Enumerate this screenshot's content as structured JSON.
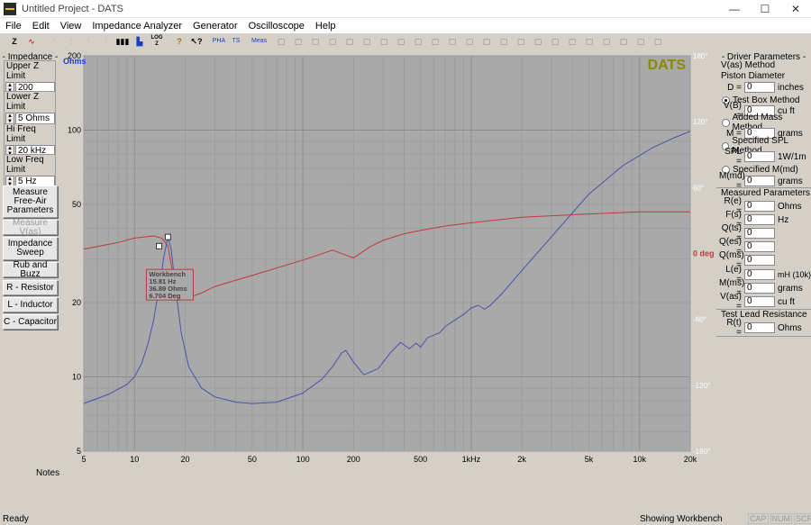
{
  "window": {
    "title": "Untitled Project - DATS",
    "min": "—",
    "max": "☐",
    "close": "✕"
  },
  "menu": [
    "File",
    "Edit",
    "View",
    "Impedance Analyzer",
    "Generator",
    "Oscilloscope",
    "Help"
  ],
  "toolbar": {
    "icons": [
      "impedance-z-icon",
      "waveform-icon",
      "measure-icon",
      "measure-icon-2",
      "measure-icon-3",
      "measure-icon-4",
      "bars-icon",
      "bar-chart-icon",
      "log-z-icon",
      "help-icon",
      "context-help-icon",
      "pha-icon",
      "ts-icon",
      "meas-icon"
    ],
    "labels": {
      "z": "Z",
      "log": "LOG Z",
      "pha": "PHA",
      "ts": "TS",
      "meas": "Meas"
    }
  },
  "left": {
    "header": "- Impedance -",
    "upper_label": "Upper Z Limit",
    "upper_value": "200 Ohms",
    "lower_label": "Lower Z Limit",
    "lower_value": "5 Ohms",
    "hi_label": "Hi Freq Limit",
    "hi_value": "20 kHz",
    "low_label": "Low Freq Limit",
    "low_value": "5 Hz",
    "btn_freeair": "Measure Free-Air Parameters",
    "btn_vas": "Measure V(as)",
    "btn_sweep": "Impedance Sweep",
    "btn_rub": "Rub and Buzz",
    "btn_r": "R - Resistor",
    "btn_l": "L - Inductor",
    "btn_c": "C - Capacitor"
  },
  "chart_data": {
    "type": "line",
    "brand": "DATS",
    "y_axis_label": "Ohms",
    "y_log": true,
    "x_log": true,
    "ylim": [
      5,
      200
    ],
    "xlim": [
      5,
      20000
    ],
    "y_ticks": [
      "5",
      "10",
      "20",
      "50",
      "100",
      "200"
    ],
    "y_ticks_values": [
      5,
      10,
      20,
      50,
      100,
      200
    ],
    "x_ticks": [
      "5",
      "10",
      "20",
      "50",
      "100",
      "200",
      "500",
      "1kHz",
      "2k",
      "5k",
      "10k",
      "20k"
    ],
    "x_ticks_values": [
      5,
      10,
      20,
      50,
      100,
      200,
      500,
      1000,
      2000,
      5000,
      10000,
      20000
    ],
    "phase_ticks": [
      "180°",
      "120°",
      "60°",
      "0 deg",
      "-60°",
      "-120°",
      "-180°"
    ],
    "phase_ticks_values": [
      180,
      120,
      60,
      0,
      -60,
      -120,
      -180
    ],
    "phase_lim": [
      -180,
      180
    ],
    "colors": {
      "impedance": "#4a50b0",
      "phase": "#c0393b",
      "zero_label": "#c0393b",
      "brand": "#8a8a00"
    },
    "series": [
      {
        "name": "Impedance",
        "axis": "ohms",
        "x": [
          5,
          7,
          9,
          10,
          11,
          12,
          13,
          14,
          15,
          15.81,
          16.5,
          17.5,
          19,
          21,
          25,
          30,
          40,
          50,
          70,
          100,
          130,
          150,
          170,
          180,
          200,
          230,
          280,
          330,
          380,
          430,
          470,
          500,
          550,
          650,
          700,
          800,
          900,
          1000,
          1100,
          1200,
          1300,
          1500,
          2000,
          3000,
          5000,
          8000,
          12000,
          16000,
          20000
        ],
        "y": [
          7.8,
          8.5,
          9.3,
          10.0,
          11.3,
          13.5,
          17.0,
          23.0,
          31.0,
          36.89,
          33.0,
          23.0,
          15.0,
          11.0,
          9.0,
          8.3,
          7.9,
          7.8,
          7.9,
          8.6,
          9.8,
          11.0,
          12.5,
          12.8,
          11.5,
          10.2,
          10.8,
          12.5,
          13.8,
          13.0,
          13.7,
          13.2,
          14.4,
          15.1,
          16.0,
          17.0,
          17.9,
          19.0,
          19.5,
          18.8,
          19.5,
          21.5,
          27.0,
          37.0,
          55.0,
          72.0,
          85.0,
          93.0,
          99.0
        ]
      },
      {
        "name": "Phase",
        "axis": "deg",
        "x": [
          5,
          8,
          10,
          13,
          14.5,
          15.81,
          16.5,
          17.5,
          19,
          21,
          25,
          30,
          50,
          100,
          150,
          200,
          250,
          300,
          400,
          500,
          700,
          1000,
          1500,
          2000,
          5000,
          10000,
          20000
        ],
        "y": [
          4,
          10,
          14,
          16,
          14,
          6.7,
          -10,
          -28,
          -36,
          -40,
          -36,
          -30,
          -20,
          -6,
          3,
          -4,
          6,
          12,
          18,
          21,
          25,
          28,
          31,
          33,
          36,
          38,
          38
        ]
      }
    ],
    "cursor": {
      "x": 15.81,
      "title": "Workbench",
      "freq": "15.81 Hz",
      "ohms": "36.89 Ohms",
      "deg": "6.704 Deg"
    }
  },
  "right": {
    "header": "- Driver Parameters -",
    "vas_method": "V(as) Method",
    "piston": "Piston Diameter",
    "d_label": "D =",
    "d_val": "0",
    "d_unit": "inches",
    "r_testbox": "Test Box Method",
    "vb_label": "V(B) =",
    "vb_val": "0",
    "vb_unit": "cu ft",
    "r_addmass": "Added Mass Method",
    "m_label": "M =",
    "m_val": "0",
    "m_unit": "grams",
    "r_spl": "Specified SPL Method",
    "spl_label": "SPL =",
    "spl_val": "0",
    "spl_unit": "1W/1m",
    "r_mmd": "Specified M(md)",
    "mmd_label": "M(md) =",
    "mmd_val": "0",
    "mmd_unit": "grams",
    "measured_header": "Measured Parameters",
    "params": [
      {
        "label": "R(e) =",
        "value": "0",
        "unit": "Ohms"
      },
      {
        "label": "F(s) =",
        "value": "0",
        "unit": "Hz"
      },
      {
        "label": "Q(ts) =",
        "value": "0",
        "unit": ""
      },
      {
        "label": "Q(es) =",
        "value": "0",
        "unit": ""
      },
      {
        "label": "Q(ms) =",
        "value": "0",
        "unit": ""
      },
      {
        "label": "L(e) =",
        "value": "0",
        "unit": "mH (10k)"
      },
      {
        "label": "M(ms) =",
        "value": "0",
        "unit": "grams"
      },
      {
        "label": "V(as) =",
        "value": "0",
        "unit": "cu ft"
      }
    ],
    "lead_header": "Test Lead Resistance",
    "rt_label": "R(t) =",
    "rt_val": "0",
    "rt_unit": "Ohms"
  },
  "notes_label": "Notes:",
  "status": {
    "left": "Ready",
    "mid": "Showing Workbench",
    "keys": [
      "CAP",
      "NUM",
      "SCRL"
    ]
  }
}
